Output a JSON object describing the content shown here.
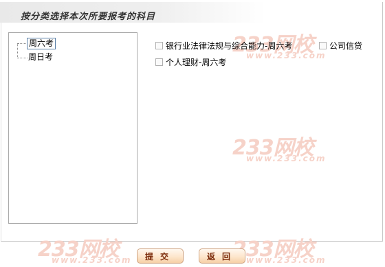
{
  "page": {
    "title": "按分类选择本次所要报考的科目"
  },
  "watermark": {
    "main": "233网校",
    "sub": "www.233.com"
  },
  "tree": {
    "items": [
      {
        "label": "周六考",
        "selected": true
      },
      {
        "label": "周日考",
        "selected": false
      }
    ]
  },
  "subjects": [
    {
      "label": "银行业法律法规与综合能力-周六考",
      "checked": false
    },
    {
      "label": "公司信贷",
      "checked": false
    },
    {
      "label": "个人理财-周六考",
      "checked": false
    }
  ],
  "buttons": {
    "submit": "提交",
    "back": "返回"
  },
  "colors": {
    "watermark": "#f6d2c8",
    "button_text": "#7a2a0a",
    "selection_border": "#5a7fa6"
  }
}
